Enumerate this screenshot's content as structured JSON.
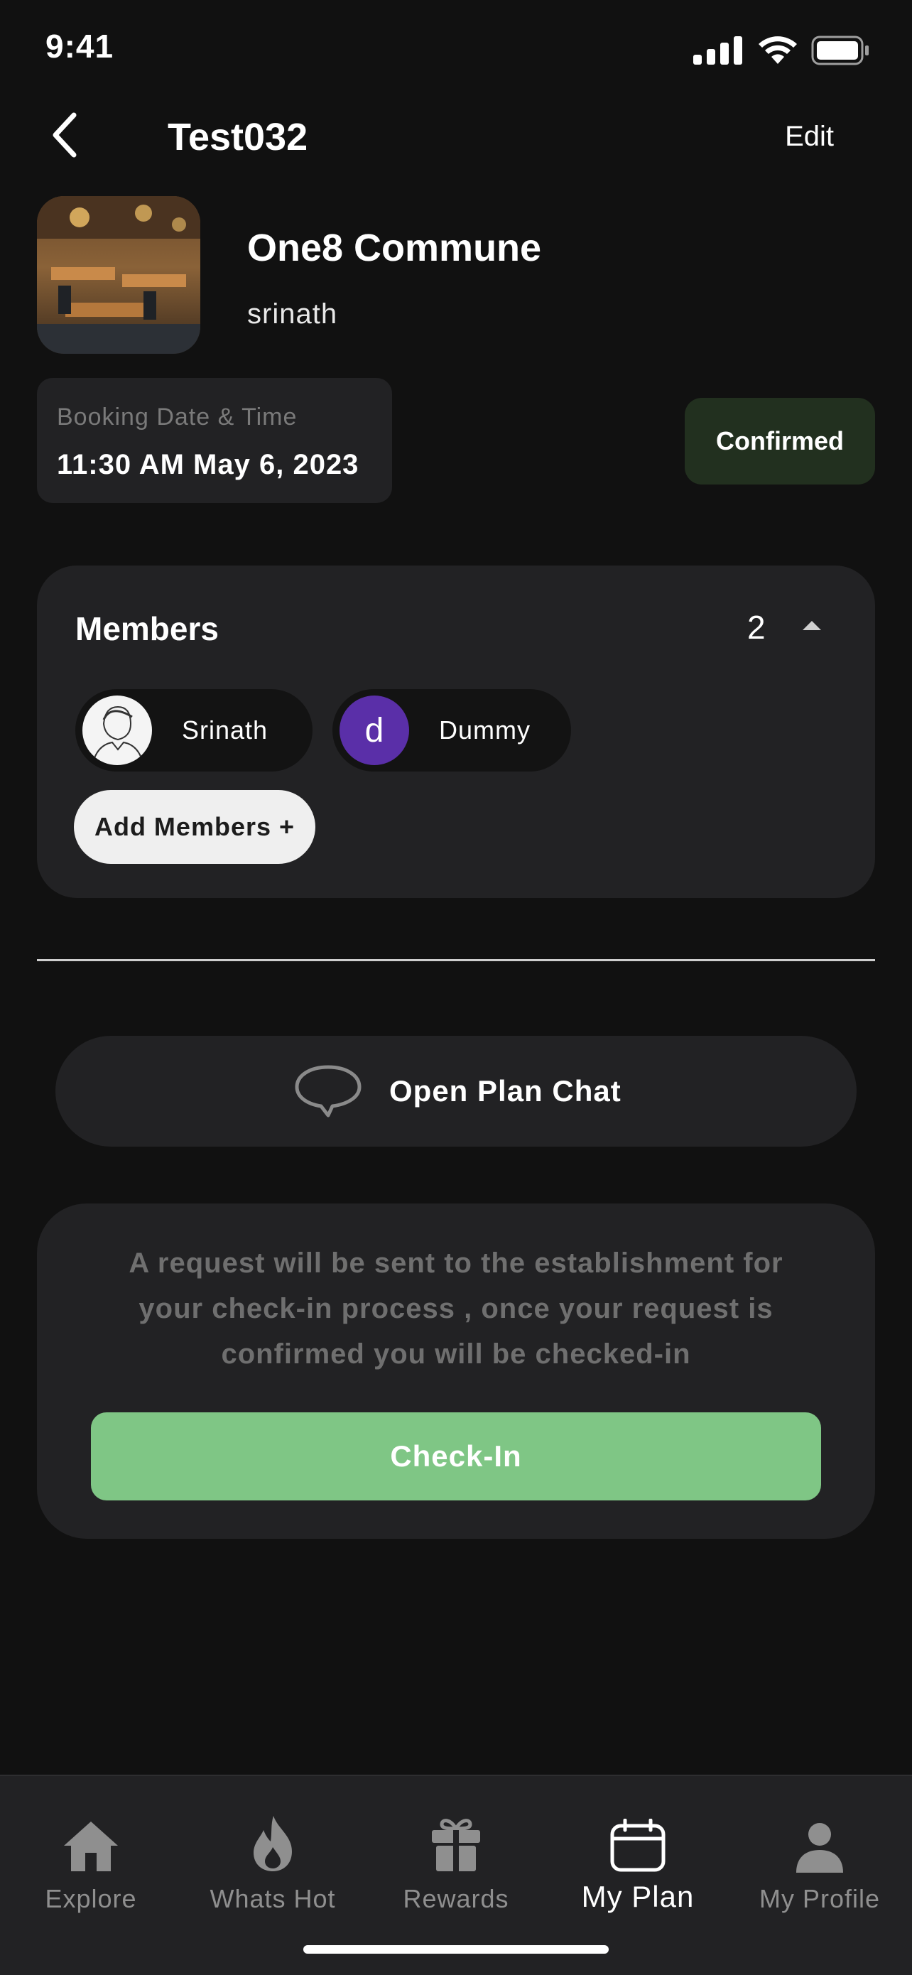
{
  "status_bar": {
    "time": "9:41"
  },
  "header": {
    "title": "Test032",
    "edit_label": "Edit"
  },
  "venue": {
    "name": "One8 Commune",
    "user": "srinath"
  },
  "booking": {
    "label": "Booking Date & Time",
    "value": "11:30 AM May 6, 2023",
    "status": "Confirmed"
  },
  "members": {
    "title": "Members",
    "count": "2",
    "list": [
      {
        "name": "Srinath",
        "avatar_initial": ""
      },
      {
        "name": "Dummy",
        "avatar_initial": "d"
      }
    ],
    "add_label": "Add Members +"
  },
  "chat": {
    "label": "Open Plan Chat"
  },
  "checkin": {
    "note": "A request will be sent to the establishment for your check-in process , once your request is confirmed you will be checked-in",
    "button_label": "Check-In"
  },
  "tabs": [
    {
      "label": "Explore",
      "icon": "home-icon",
      "active": false
    },
    {
      "label": "Whats Hot",
      "icon": "flame-icon",
      "active": false
    },
    {
      "label": "Rewards",
      "icon": "gift-icon",
      "active": false
    },
    {
      "label": "My Plan",
      "icon": "calendar-icon",
      "active": true
    },
    {
      "label": "My Profile",
      "icon": "user-icon",
      "active": false
    }
  ],
  "colors": {
    "background": "#111111",
    "card": "#222224",
    "confirmed_chip": "#22301f",
    "checkin_button": "#7fc685",
    "avatar_purple": "#5a2fa8"
  }
}
